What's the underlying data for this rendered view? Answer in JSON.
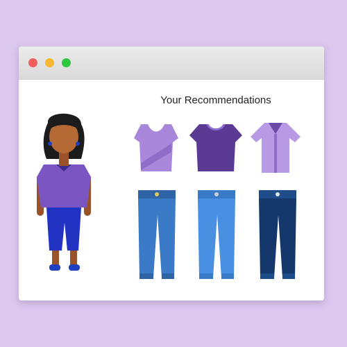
{
  "window": {
    "controls": [
      {
        "name": "close",
        "color": "#f25f5c"
      },
      {
        "name": "minimize",
        "color": "#f7b733"
      },
      {
        "name": "maximize",
        "color": "#2bc93f"
      }
    ]
  },
  "recommendations": {
    "title": "Your Recommendations",
    "tops": [
      {
        "name": "top-light-sash-icon",
        "color": "#a987db"
      },
      {
        "name": "top-dark-tee-icon",
        "color": "#5a3a93"
      },
      {
        "name": "top-light-shirt-icon",
        "color": "#b79ae3"
      }
    ],
    "bottoms": [
      {
        "name": "jeans-medium-icon",
        "color": "#3b7ac7"
      },
      {
        "name": "jeans-light-icon",
        "color": "#4a90e2"
      },
      {
        "name": "jeans-dark-icon",
        "color": "#14386b"
      }
    ]
  },
  "avatar": {
    "name": "person-avatar",
    "shirt_color": "#7b56c2",
    "pants_color": "#2233c4"
  }
}
